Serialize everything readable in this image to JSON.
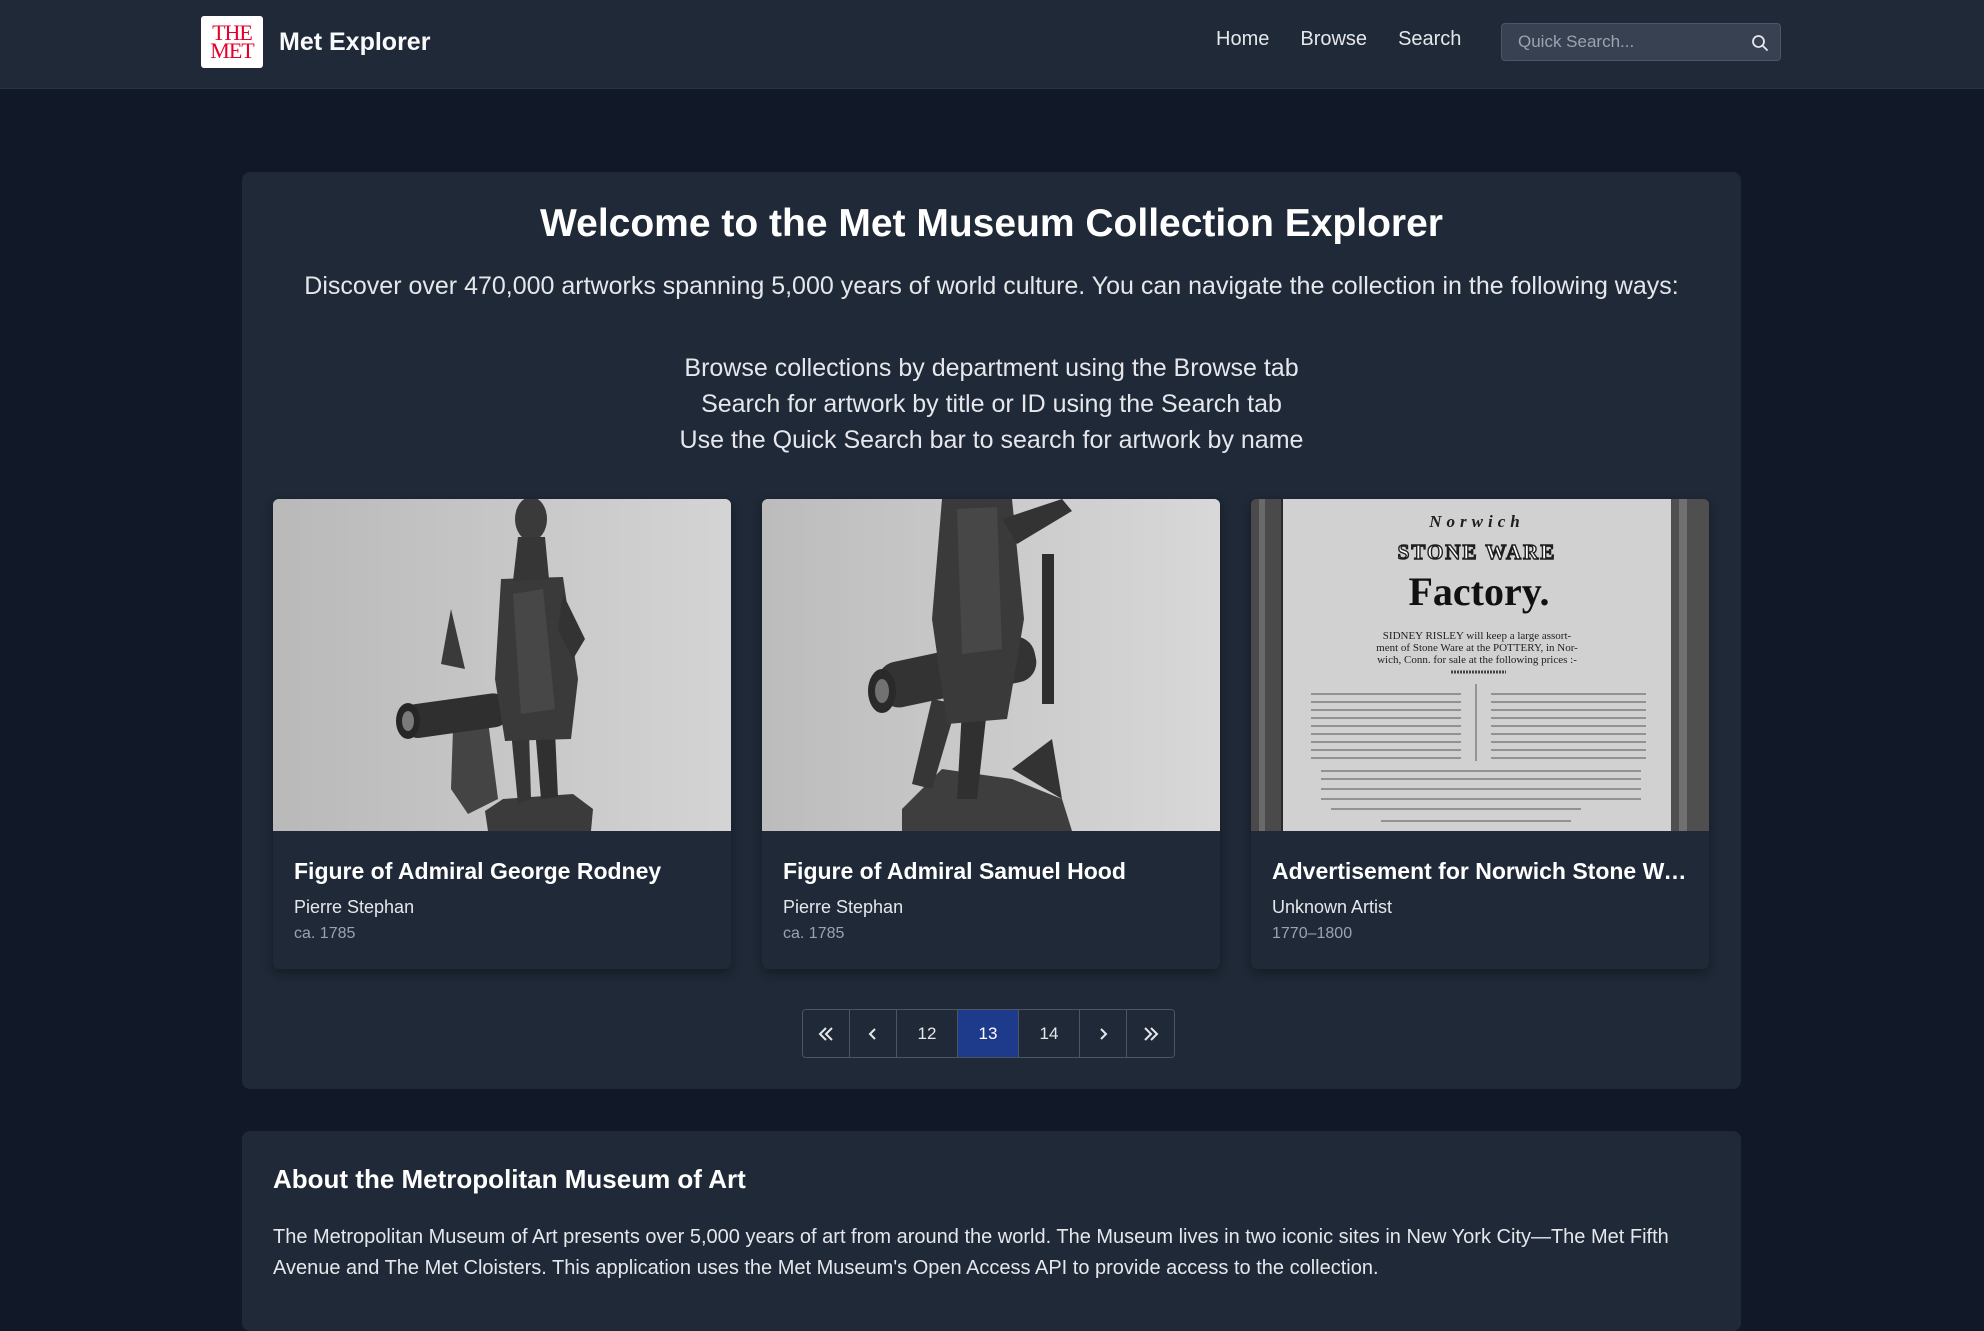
{
  "navbar": {
    "logo_line1": "THE",
    "logo_line2": "MET",
    "brand_name": "Met Explorer",
    "links": [
      "Home",
      "Browse",
      "Search"
    ],
    "quick_search_placeholder": "Quick Search...",
    "quick_search_value": ""
  },
  "hero": {
    "title": "Welcome to the Met Museum Collection Explorer",
    "intro": "Discover over 470,000 artworks spanning 5,000 years of world culture. You can navigate the collection in the following ways:",
    "ways": [
      "Browse collections by department using the Browse tab",
      "Search for artwork by title or ID using the Search tab",
      "Use the Quick Search bar to search for artwork by name"
    ]
  },
  "cards": [
    {
      "title": "Figure of Admiral George Rodney",
      "artist": "Pierre Stephan",
      "date": "ca. 1785"
    },
    {
      "title": "Figure of Admiral Samuel Hood",
      "artist": "Pierre Stephan",
      "date": "ca. 1785"
    },
    {
      "title": "Advertisement for Norwich Stone Ware Factory",
      "artist": "Unknown Artist",
      "date": "1770–1800",
      "poster_line1": "Norwich",
      "poster_line2": "STONE WARE",
      "poster_line3": "Factory.",
      "poster_line4": "SIDNEY RISLEY will keep a large assort-",
      "poster_line5": "ment of Stone Ware at the POTTERY, in Nor-",
      "poster_line6": "wich, Conn. for sale at the following prices :-"
    }
  ],
  "pagination": {
    "pages": [
      "12",
      "13",
      "14"
    ],
    "current": "13"
  },
  "about": {
    "title": "About the Metropolitan Museum of Art",
    "text": "The Metropolitan Museum of Art presents over 5,000 years of art from around the world. The Museum lives in two iconic sites in New York City—The Met Fifth Avenue and The Met Cloisters. This application uses the Met Museum's Open Access API to provide access to the collection."
  },
  "colors": {
    "background": "#111827",
    "surface": "#1f2937",
    "active_page": "#1e3a8a",
    "logo_red": "#e4002b"
  }
}
